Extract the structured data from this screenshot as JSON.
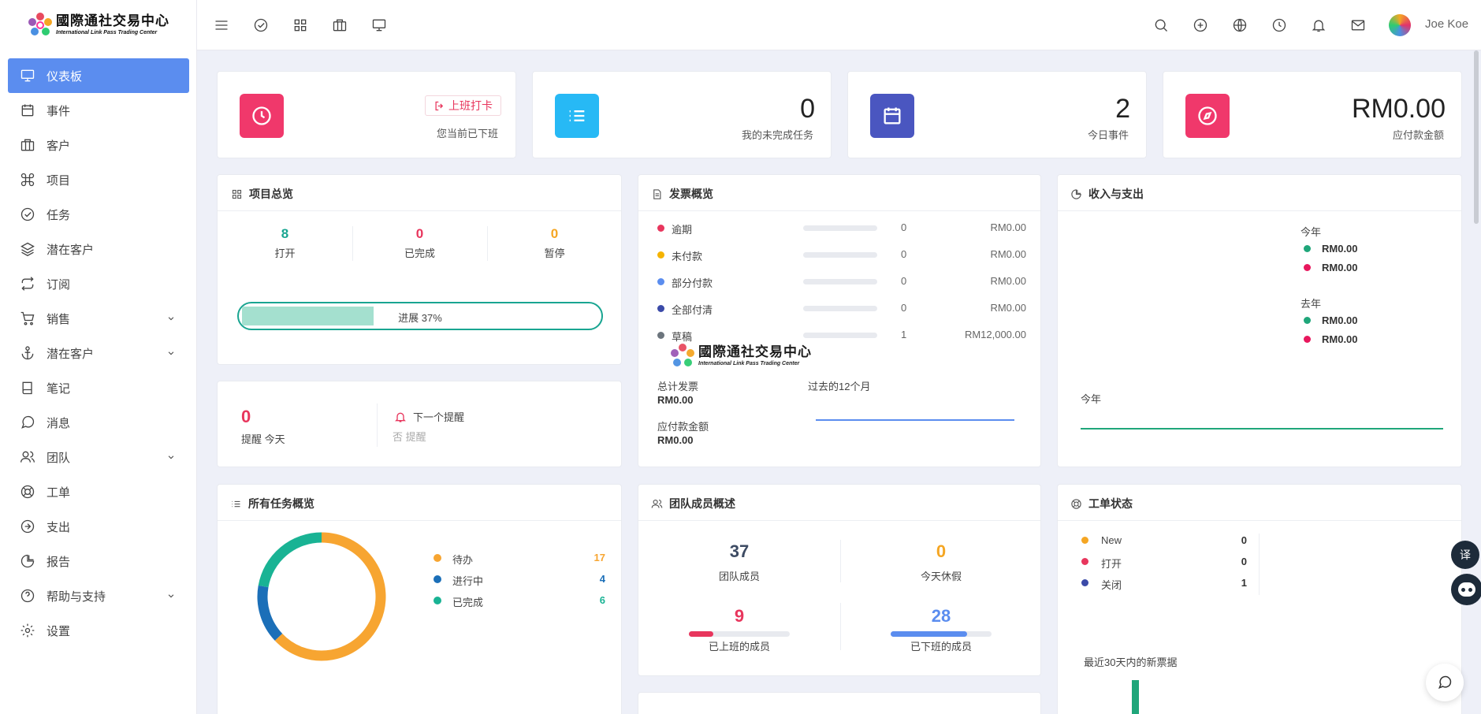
{
  "brand": {
    "name_cn": "國際通社交易中心",
    "name_en": "International Link Pass Trading Center"
  },
  "sidebar": {
    "items": [
      {
        "label": "仪表板",
        "icon": "monitor-icon",
        "active": true
      },
      {
        "label": "事件",
        "icon": "calendar-icon"
      },
      {
        "label": "客户",
        "icon": "briefcase-icon"
      },
      {
        "label": "项目",
        "icon": "command-icon"
      },
      {
        "label": "任务",
        "icon": "check-circle-icon"
      },
      {
        "label": "潜在客户",
        "icon": "layers-icon"
      },
      {
        "label": "订阅",
        "icon": "repeat-icon"
      },
      {
        "label": "销售",
        "icon": "cart-icon",
        "expandable": true
      },
      {
        "label": "潜在客户",
        "icon": "anchor-icon",
        "expandable": true
      },
      {
        "label": "笔记",
        "icon": "book-icon"
      },
      {
        "label": "消息",
        "icon": "message-icon"
      },
      {
        "label": "团队",
        "icon": "users-icon",
        "expandable": true
      },
      {
        "label": "工单",
        "icon": "life-buoy-icon"
      },
      {
        "label": "支出",
        "icon": "arrow-right-circle-icon"
      },
      {
        "label": "报告",
        "icon": "pie-chart-icon"
      },
      {
        "label": "帮助与支持",
        "icon": "help-circle-icon",
        "expandable": true
      },
      {
        "label": "设置",
        "icon": "settings-icon"
      }
    ]
  },
  "topbar": {
    "user": "Joe Koe"
  },
  "stats": {
    "clock": {
      "button": "上班打卡",
      "status": "您当前已下班",
      "color": "#f0386b"
    },
    "tasks": {
      "value": "0",
      "label": "我的未完成任务",
      "color": "#27b9f5"
    },
    "events": {
      "value": "2",
      "label": "今日事件",
      "color": "#4a56c0"
    },
    "due": {
      "value": "RM0.00",
      "label": "应付款金额",
      "color": "#f0386b"
    }
  },
  "projects": {
    "title": "项目总览",
    "open": {
      "value": "8",
      "label": "打开"
    },
    "done": {
      "value": "0",
      "label": "已完成"
    },
    "paused": {
      "value": "0",
      "label": "暂停"
    },
    "progress_label": "进展 37%",
    "progress": 0.37
  },
  "reminders": {
    "count": "0",
    "count_label": "提醒 今天",
    "next_title": "下一个提醒",
    "next_value": "否 提醒"
  },
  "invoices": {
    "title": "发票概览",
    "rows": [
      {
        "label": "逾期",
        "count": "0",
        "amount": "RM0.00",
        "color": "#e8365d",
        "fill": 0
      },
      {
        "label": "未付款",
        "count": "0",
        "amount": "RM0.00",
        "color": "#f5b300",
        "fill": 0
      },
      {
        "label": "部分付款",
        "count": "0",
        "amount": "RM0.00",
        "color": "#5b8def",
        "fill": 0
      },
      {
        "label": "全部付清",
        "count": "0",
        "amount": "RM0.00",
        "color": "#3b4aa8",
        "fill": 0
      },
      {
        "label": "草稿",
        "count": "1",
        "amount": "RM12,000.00",
        "color": "#6c757d",
        "fill": 0
      }
    ],
    "total_label": "总计发票",
    "total_value": "RM0.00",
    "due_label": "应付款金额",
    "due_value": "RM0.00",
    "period_label": "过去的12个月"
  },
  "income": {
    "title": "收入与支出",
    "this_year": "今年",
    "last_year": "去年",
    "values": [
      "RM0.00",
      "RM0.00",
      "RM0.00",
      "RM0.00"
    ],
    "colors": [
      "#1fa67a",
      "#e8175d"
    ],
    "chart_label": "今年"
  },
  "tasks_overview": {
    "title": "所有任务概览",
    "items": [
      {
        "label": "待办",
        "value": 17,
        "color": "#f7a531"
      },
      {
        "label": "进行中",
        "value": 4,
        "color": "#1b6fb8"
      },
      {
        "label": "已完成",
        "value": 6,
        "color": "#19b394"
      }
    ]
  },
  "team": {
    "title": "团队成员概述",
    "members": {
      "value": "37",
      "label": "团队成员"
    },
    "leave": {
      "value": "0",
      "label": "今天休假"
    },
    "in": {
      "value": "9",
      "label": "已上班的成员",
      "fill": 0.24
    },
    "out": {
      "value": "28",
      "label": "已下班的成员",
      "fill": 0.76
    }
  },
  "tickets": {
    "title": "工单状态",
    "rows": [
      {
        "label": "New",
        "value": "0",
        "color": "#f5a623"
      },
      {
        "label": "打开",
        "value": "0",
        "color": "#e8365d"
      },
      {
        "label": "关闭",
        "value": "1",
        "color": "#3b4aa8"
      }
    ],
    "chart_label": "最近30天内的新票据"
  }
}
